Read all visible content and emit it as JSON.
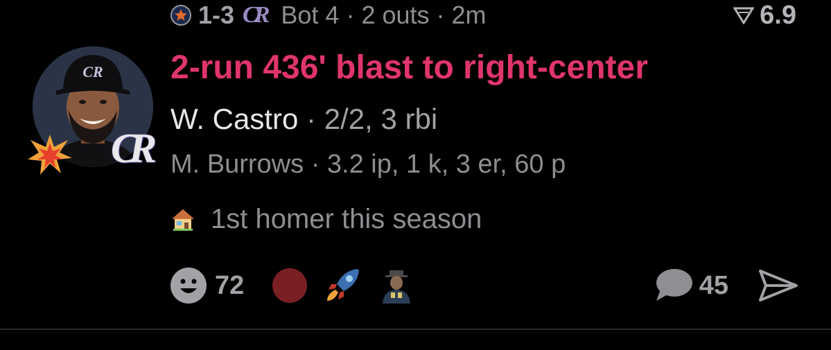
{
  "game": {
    "score": "1-3",
    "inning": "Bot 4",
    "outs": "2 outs",
    "time_ago": "2m",
    "leverage": "6.9",
    "rockies_logo_text": "CR"
  },
  "play": {
    "headline": "2-run 436' blast to right-center",
    "batter_name": "W. Castro",
    "batter_stats": "2/2, 3 rbi",
    "pitcher_name": "M. Burrows",
    "pitcher_stats": "3.2 ip, 1 k, 3 er, 60 p",
    "note": "1st homer this season",
    "team_badge": "CR",
    "separator": "·"
  },
  "reactions": {
    "smile_count": "72",
    "comment_count": "45"
  },
  "colors": {
    "headline": "#e0356b",
    "background": "#000000",
    "muted_text": "#8e8e93",
    "red_dot": "#7a1f24"
  },
  "icons": [
    "astros-logo-icon",
    "rockies-logo-icon",
    "leverage-icon",
    "burst-icon",
    "house-icon",
    "smile-icon",
    "red-dot-icon",
    "rocket-icon",
    "person-emoji-icon",
    "comment-icon",
    "send-icon"
  ]
}
